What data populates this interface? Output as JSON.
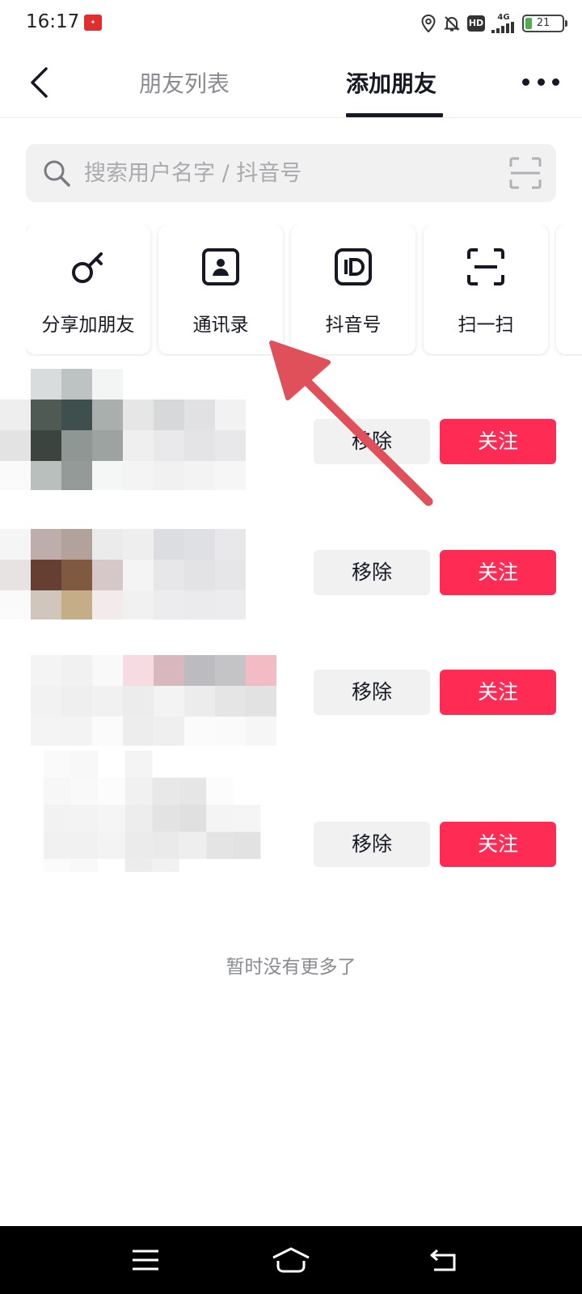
{
  "status_bar": {
    "time": "16:17",
    "network": "4G",
    "battery": "21",
    "hd_label": "HD"
  },
  "header": {
    "tabs": [
      {
        "label": "朋友列表",
        "active": false
      },
      {
        "label": "添加朋友",
        "active": true
      }
    ]
  },
  "search": {
    "placeholder": "搜索用户名字 / 抖音号"
  },
  "quick_actions": [
    {
      "label": "分享加朋友",
      "icon": "key-icon"
    },
    {
      "label": "通讯录",
      "icon": "contacts-icon"
    },
    {
      "label": "抖音号",
      "icon": "id-icon"
    },
    {
      "label": "扫一扫",
      "icon": "scan-icon"
    }
  ],
  "list": {
    "rows": [
      {
        "remove_label": "移除",
        "follow_label": "关注"
      },
      {
        "remove_label": "移除",
        "follow_label": "关注"
      },
      {
        "remove_label": "移除",
        "follow_label": "关注"
      },
      {
        "remove_label": "移除",
        "follow_label": "关注"
      }
    ],
    "end_text": "暂时没有更多了"
  },
  "colors": {
    "accent": "#fe2c55",
    "annotation_arrow": "#e0505a"
  }
}
